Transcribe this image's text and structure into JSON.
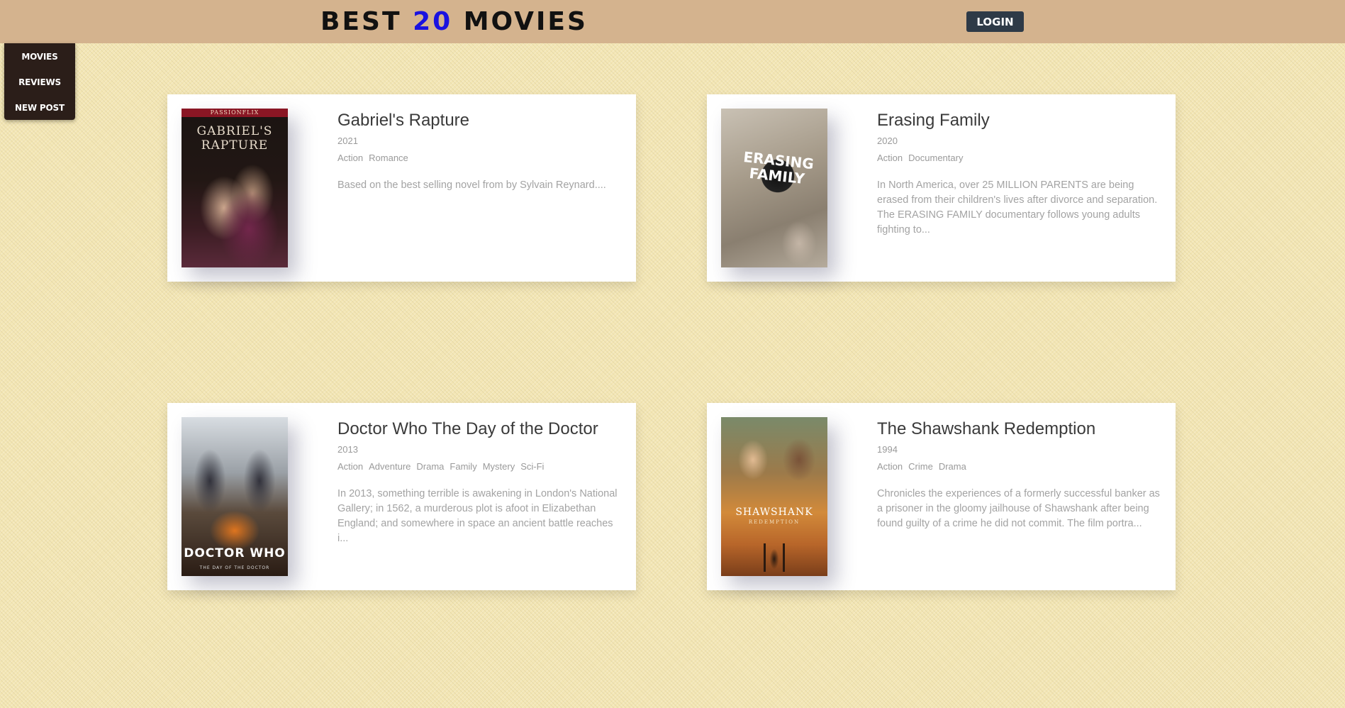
{
  "header": {
    "title_prefix": "BEST ",
    "title_number": "20",
    "title_suffix": " MOVIES",
    "login_label": "LOGIN"
  },
  "menu": {
    "items": [
      {
        "label": "MOVIES"
      },
      {
        "label": "REVIEWS"
      },
      {
        "label": "NEW POST"
      }
    ]
  },
  "movies": [
    {
      "title": "Gabriel's Rapture",
      "year": "2021",
      "genres": [
        "Action",
        "Romance"
      ],
      "description": "Based on the best selling novel from by Sylvain Reynard....",
      "poster": {
        "top_text": "PASSIONFLIX",
        "title_text": "GABRIEL'S RAPTURE"
      }
    },
    {
      "title": "Erasing Family",
      "year": "2020",
      "genres": [
        "Action",
        "Documentary"
      ],
      "description": "In North America, over 25 MILLION PARENTS are being erased from their children's lives after divorce and separation. The ERASING FAMILY documentary follows young adults fighting to...",
      "poster": {
        "title_text": "ERASING FAMILY"
      }
    },
    {
      "title": "Doctor Who The Day of the Doctor",
      "year": "2013",
      "genres": [
        "Action",
        "Adventure",
        "Drama",
        "Family",
        "Mystery",
        "Sci-Fi"
      ],
      "description": "In 2013, something terrible is awakening in London's National Gallery; in 1562, a murderous plot is afoot in Elizabethan England; and somewhere in space an ancient battle reaches i...",
      "poster": {
        "title_text": "DOCTOR WHO",
        "subtitle_text": "THE DAY OF THE DOCTOR"
      }
    },
    {
      "title": "The Shawshank Redemption",
      "year": "1994",
      "genres": [
        "Action",
        "Crime",
        "Drama"
      ],
      "description": "Chronicles the experiences of a formerly successful banker as a prisoner in the gloomy jailhouse of Shawshank after being found guilty of a crime he did not commit. The film portra...",
      "poster": {
        "title_text": "SHAWSHANK",
        "subtitle_text": "REDEMPTION"
      }
    }
  ]
}
